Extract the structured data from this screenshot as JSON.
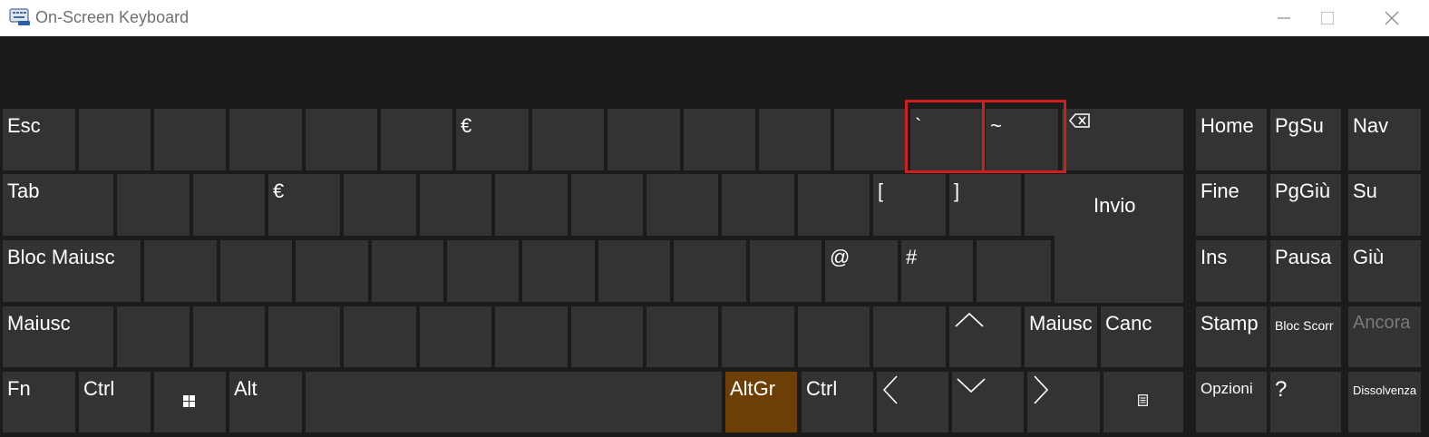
{
  "window": {
    "title": "On-Screen Keyboard",
    "icon": "keyboard-app-icon",
    "controls": [
      "minimize-icon",
      "maximize-icon",
      "close-icon"
    ]
  },
  "colors": {
    "background": "#1b1b1b",
    "key": "#333333",
    "key_text": "#ffffff",
    "altgr_active": "#6d3f06",
    "highlight": "#d11f1f"
  },
  "keys": {
    "esc": "Esc",
    "euro1": "€",
    "backtick": "`",
    "tilde": "~",
    "tab": "Tab",
    "euro2": "€",
    "bracket_open": "[",
    "bracket_close": "]",
    "invio": "Invio",
    "bloc_maiusc": "Bloc Maiusc",
    "at": "@",
    "hash": "#",
    "maiusc_left": "Maiusc",
    "maiusc_right": "Maiusc",
    "canc": "Canc",
    "fn": "Fn",
    "ctrl_left": "Ctrl",
    "alt": "Alt",
    "altgr": "AltGr",
    "ctrl_right": "Ctrl",
    "home": "Home",
    "pgsu": "PgSu",
    "nav": "Nav",
    "fine": "Fine",
    "pggiu": "PgGiù",
    "su": "Su",
    "ins": "Ins",
    "pausa": "Pausa",
    "giu": "Giù",
    "stamp": "Stamp",
    "bloc_scorr": "Bloc Scorr",
    "ancora": "Ancora",
    "opzioni": "Opzioni",
    "help": "?",
    "dissolvenza": "Dissolvenza"
  }
}
